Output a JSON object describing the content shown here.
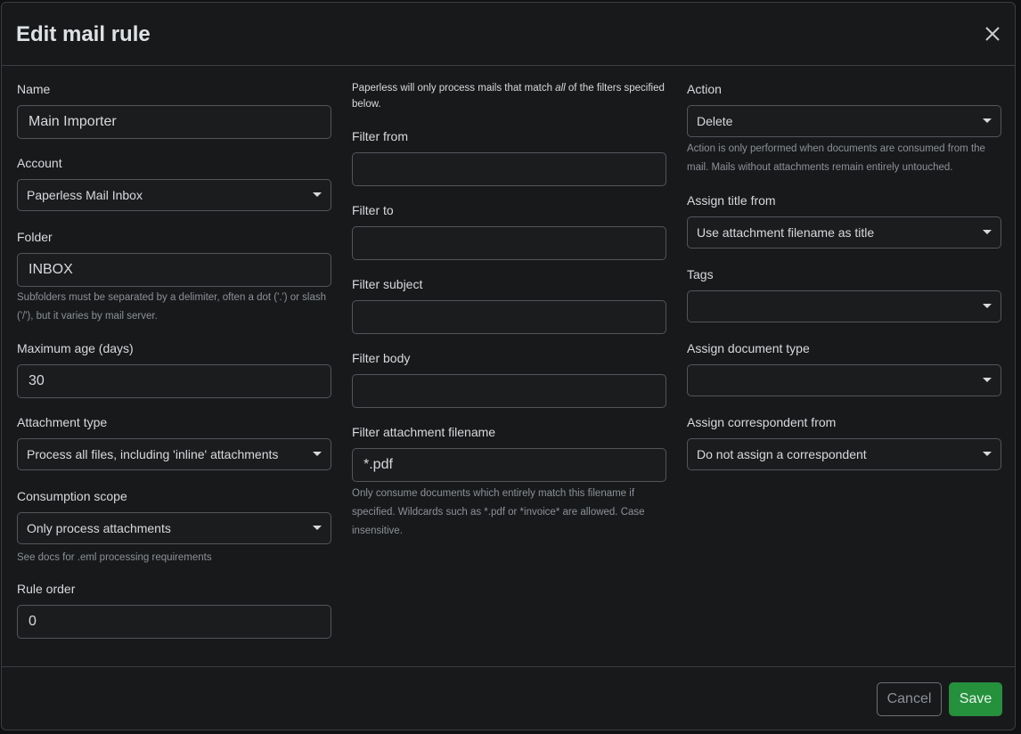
{
  "modal": {
    "title": "Edit mail rule"
  },
  "form": {
    "name": {
      "label": "Name",
      "value": "Main Importer"
    },
    "account": {
      "label": "Account",
      "value": "Paperless Mail Inbox"
    },
    "folder": {
      "label": "Folder",
      "value": "INBOX",
      "help": "Subfolders must be separated by a delimiter, often a dot ('.') or slash ('/'), but it varies by mail server."
    },
    "maximum_age": {
      "label": "Maximum age (days)",
      "value": "30"
    },
    "attachment_type": {
      "label": "Attachment type",
      "value": "Process all files, including 'inline' attachments"
    },
    "consumption_scope": {
      "label": "Consumption scope",
      "value": "Only process attachments",
      "help": "See docs for .eml processing requirements"
    },
    "rule_order": {
      "label": "Rule order",
      "value": "0"
    },
    "filters_intro": {
      "before": "Paperless will only process mails that match ",
      "emphasis": "all",
      "after": " of the filters specified below."
    },
    "filter_from": {
      "label": "Filter from",
      "value": ""
    },
    "filter_to": {
      "label": "Filter to",
      "value": ""
    },
    "filter_subject": {
      "label": "Filter subject",
      "value": ""
    },
    "filter_body": {
      "label": "Filter body",
      "value": ""
    },
    "filter_attachment_filename": {
      "label": "Filter attachment filename",
      "value": "*.pdf",
      "help": "Only consume documents which entirely match this filename if specified. Wildcards such as *.pdf or *invoice* are allowed. Case insensitive."
    },
    "action": {
      "label": "Action",
      "value": "Delete",
      "help": "Action is only performed when documents are consumed from the mail. Mails without attachments remain entirely untouched."
    },
    "assign_title_from": {
      "label": "Assign title from",
      "value": "Use attachment filename as title"
    },
    "tags": {
      "label": "Tags",
      "value": ""
    },
    "assign_document_type": {
      "label": "Assign document type",
      "value": ""
    },
    "assign_correspondent_from": {
      "label": "Assign correspondent from",
      "value": "Do not assign a correspondent"
    }
  },
  "footer": {
    "cancel_label": "Cancel",
    "save_label": "Save"
  },
  "icons": {
    "close": "close-icon",
    "dropdown": "chevron-down-icon"
  },
  "colors": {
    "save_button": "#25913c",
    "modal_background": "#18191b",
    "border": "#3b3e42"
  }
}
